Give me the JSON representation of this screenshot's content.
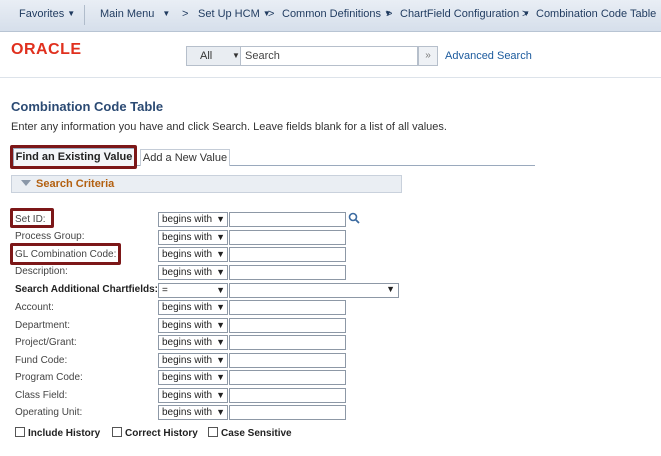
{
  "nav": {
    "favorites": "Favorites",
    "main_menu": "Main Menu",
    "breadcrumb": [
      ">",
      "Set Up HCM",
      ">",
      "Common Definitions",
      ">",
      "ChartField Configuration",
      ">",
      "Combination Code Table"
    ]
  },
  "header": {
    "logo": "ORACLE",
    "search_scope": "All",
    "search_placeholder": "Search",
    "go_label": "»",
    "advanced_search": "Advanced Search"
  },
  "page": {
    "title": "Combination Code Table",
    "instructions": "Enter any information you have and click Search. Leave fields blank for a list of all values.",
    "tabs": {
      "find": "Find an Existing Value",
      "add": "Add a New Value"
    },
    "criteria_title": "Search Criteria"
  },
  "fields": [
    {
      "label": "Set ID:",
      "operator": "begins with",
      "value": ""
    },
    {
      "label": "Process Group:",
      "operator": "begins with",
      "value": ""
    },
    {
      "label": "GL Combination Code:",
      "operator": "begins with",
      "value": ""
    },
    {
      "label": "Description:",
      "operator": "begins with",
      "value": ""
    },
    {
      "label": "Search Additional Chartfields:",
      "operator": "=",
      "value": ""
    },
    {
      "label": "Account:",
      "operator": "begins with",
      "value": ""
    },
    {
      "label": "Department:",
      "operator": "begins with",
      "value": ""
    },
    {
      "label": "Project/Grant:",
      "operator": "begins with",
      "value": ""
    },
    {
      "label": "Fund Code:",
      "operator": "begins with",
      "value": ""
    },
    {
      "label": "Program Code:",
      "operator": "begins with",
      "value": ""
    },
    {
      "label": "Class Field:",
      "operator": "begins with",
      "value": ""
    },
    {
      "label": "Operating Unit:",
      "operator": "begins with",
      "value": ""
    }
  ],
  "checkboxes": {
    "include_history": "Include History",
    "correct_history": "Correct History",
    "case_sensitive": "Case Sensitive"
  },
  "colors": {
    "accent": "#2b4a73",
    "highlight_border": "#7c1718",
    "criteria_text": "#b36010",
    "oracle_red": "#e0301e"
  }
}
